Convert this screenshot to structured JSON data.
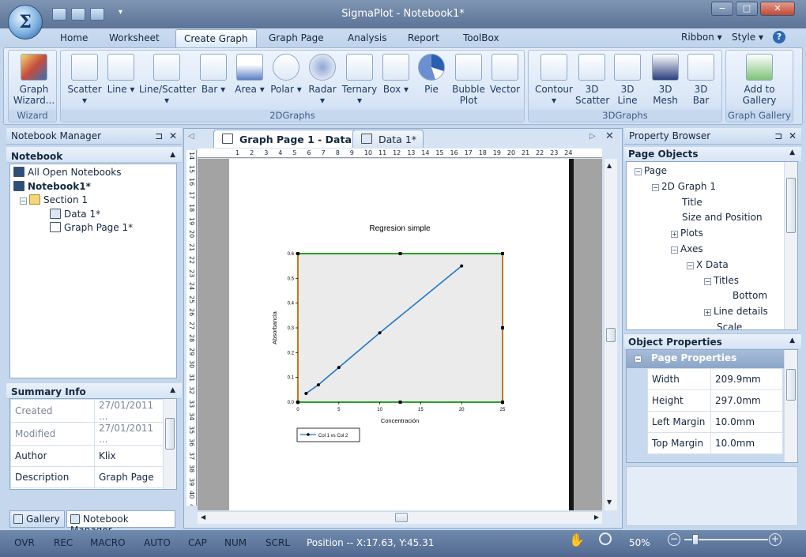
{
  "window": {
    "title": "SigmaPlot - Notebook1*",
    "logo": "Σ",
    "win_minimize": "−",
    "win_restore": "□",
    "win_close": "✕"
  },
  "ribbon_tabs": [
    "Home",
    "Worksheet",
    "Create Graph",
    "Graph Page",
    "Analysis",
    "Report",
    "ToolBox"
  ],
  "ribbon_right": {
    "ribbon": "Ribbon",
    "style": "Style",
    "help": "?"
  },
  "groups": {
    "wizard": "Wizard",
    "graphs2d": "2DGraphs",
    "graphs3d": "3DGraphs",
    "gallery": "Graph Gallery"
  },
  "buttons": {
    "wizard": "Graph\nWizard...",
    "scatter": "Scatter",
    "line": "Line",
    "line_scatter": "Line/Scatter",
    "bar": "Bar",
    "area": "Area",
    "polar": "Polar",
    "radar": "Radar",
    "ternary": "Ternary",
    "box": "Box",
    "pie": "Pie",
    "bubble": "Bubble\nPlot",
    "vector": "Vector",
    "contour": "Contour",
    "scatter3d": "3D\nScatter",
    "line3d": "3D\nLine",
    "mesh3d": "3D\nMesh",
    "bar3d": "3D\nBar",
    "gallery": "Add to\nGallery"
  },
  "notebook_manager": {
    "title": "Notebook Manager",
    "section": "Notebook",
    "items": [
      "All Open Notebooks",
      "Notebook1*",
      "Section 1",
      "Data 1*",
      "Graph Page 1*"
    ]
  },
  "summary": {
    "title": "Summary Info",
    "rows": [
      [
        "Created",
        "27/01/2011 ..."
      ],
      [
        "Modified",
        "27/01/2011 ..."
      ],
      [
        "Author",
        "Klix"
      ],
      [
        "Description",
        "Graph Page"
      ]
    ]
  },
  "bottom_tabs": {
    "gallery": "Gallery",
    "manager": "Notebook Manager"
  },
  "doc_tabs": [
    "Graph Page 1 - Data 1*",
    "Data 1*"
  ],
  "ruler_h": [
    "1",
    "2",
    "3",
    "4",
    "5",
    "6",
    "7",
    "8",
    "9",
    "10",
    "11",
    "12",
    "13",
    "14",
    "15",
    "16",
    "17",
    "18",
    "19",
    "20",
    "21",
    "22",
    "23",
    "24"
  ],
  "ruler_v": [
    "14",
    "15",
    "16",
    "17",
    "18",
    "19",
    "20",
    "21",
    "22",
    "23",
    "24",
    "25",
    "26",
    "27",
    "28",
    "29",
    "30",
    "31",
    "32",
    "33",
    "34",
    "35",
    "36",
    "37",
    "38",
    "39",
    "40",
    "41"
  ],
  "chart_data": {
    "type": "line",
    "title": "Regresion simple",
    "xlabel": "Concentración",
    "ylabel": "Absorbancia",
    "xlim": [
      0,
      25
    ],
    "ylim": [
      0,
      0.6
    ],
    "xticks": [
      "0",
      "5",
      "10",
      "15",
      "20",
      "25"
    ],
    "yticks": [
      "0.0",
      "0.1",
      "0.2",
      "0.3",
      "0.4",
      "0.5",
      "0.6"
    ],
    "series": [
      {
        "name": "Col 1 vs Col 2",
        "x": [
          1,
          2.5,
          5,
          10,
          20
        ],
        "y": [
          0.035,
          0.07,
          0.14,
          0.28,
          0.55
        ]
      }
    ]
  },
  "property_browser": {
    "title": "Property Browser",
    "page_objects": "Page Objects",
    "tree": [
      "Page",
      "2D Graph 1",
      "Title",
      "Size and Position",
      "Plots",
      "Axes",
      "X Data",
      "Titles",
      "Bottom",
      "Line details",
      "Scale"
    ]
  },
  "object_properties": {
    "title": "Object Properties",
    "group": "Page Properties",
    "rows": [
      [
        "Width",
        "209.9mm"
      ],
      [
        "Height",
        "297.0mm"
      ],
      [
        "Left Margin",
        "10.0mm"
      ],
      [
        "Top Margin",
        "10.0mm"
      ]
    ]
  },
  "status": {
    "items": [
      "OVR",
      "REC",
      "MACRO",
      "AUTO",
      "CAP",
      "NUM",
      "SCRL"
    ],
    "position": "Position -- X:17.63, Y:45.31",
    "zoom": "50%"
  },
  "colors": {
    "frame": "#6f85a7",
    "ribbon": "#dbe7f6",
    "plot_bg": "#ebebeb",
    "x_axis": "#2aa02a",
    "y_axis": "#c07a1a",
    "series": "#1f78c8"
  }
}
